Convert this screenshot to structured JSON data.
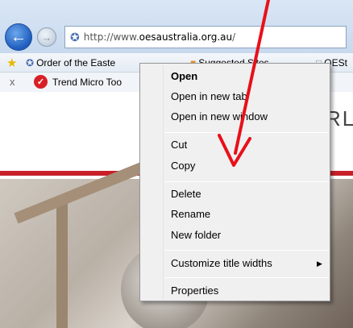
{
  "browser": {
    "address_url_prefix": "http://www.",
    "address_url_domain": "oesaustralia.org.au",
    "address_url_suffix": "/"
  },
  "favorites_bar": {
    "items": [
      {
        "label": "Order of the Easte",
        "icon": "star-site-icon"
      },
      {
        "label": "Suggested Sites",
        "icon": "suggested-sites-icon"
      },
      {
        "label": "OESt",
        "icon": "page-icon"
      }
    ]
  },
  "toolbar": {
    "close_glyph": "x",
    "name": "Trend Micro Too"
  },
  "page": {
    "partial_text": "RLI"
  },
  "context_menu": {
    "items": [
      {
        "label": "Open",
        "default": true
      },
      {
        "label": "Open in new tab"
      },
      {
        "label": "Open in new window"
      },
      {
        "label": "Cut"
      },
      {
        "label": "Copy"
      },
      {
        "label": "Delete"
      },
      {
        "label": "Rename"
      },
      {
        "label": "New folder"
      },
      {
        "label": "Customize title widths",
        "has_submenu": true
      },
      {
        "label": "Properties"
      }
    ]
  },
  "colors": {
    "annotation_arrow": "#e8101a",
    "accent_red_line": "#c8202a"
  }
}
